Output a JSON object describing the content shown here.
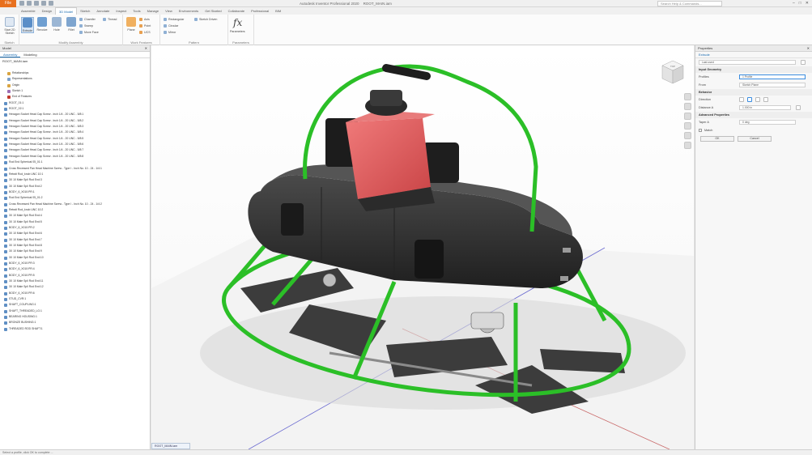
{
  "app": {
    "file_label": "File",
    "window_title": "Autodesk Inventor Professional 2020",
    "document_tab": "ROOT_MAIN.iam",
    "search_placeholder": "Search Help & Commands..."
  },
  "ribbon_tabs": [
    {
      "label": "Assemble",
      "active": false
    },
    {
      "label": "Design",
      "active": false
    },
    {
      "label": "3D Model",
      "active": true
    },
    {
      "label": "Sketch",
      "active": false
    },
    {
      "label": "Annotate",
      "active": false
    },
    {
      "label": "Inspect",
      "active": false
    },
    {
      "label": "Tools",
      "active": false
    },
    {
      "label": "Manage",
      "active": false
    },
    {
      "label": "View",
      "active": false
    },
    {
      "label": "Environments",
      "active": false
    },
    {
      "label": "Get Started",
      "active": false
    },
    {
      "label": "Collaborate",
      "active": false
    },
    {
      "label": "Professional",
      "active": false
    },
    {
      "label": "BIM",
      "active": false
    }
  ],
  "ribbon": {
    "groups": [
      {
        "label": "Sketch"
      },
      {
        "label": "Modify Assembly"
      },
      {
        "label": "Work Features"
      },
      {
        "label": "Pattern"
      },
      {
        "label": "Parameters"
      }
    ],
    "start_sketch": "Start 2D Sketch",
    "extrude": "Extrude",
    "revolve": "Revolve",
    "hole": "Hole",
    "fillet": "Fillet",
    "chamfer": "Chamfer",
    "sweep": "Sweep",
    "move_face": "Move Face",
    "thread": "Thread",
    "plane": "Plane",
    "axis": "Axis",
    "point": "Point",
    "ucs": "UCS",
    "rectangular": "Rectangular",
    "circular": "Circular",
    "mirror": "Mirror",
    "sketch_driven": "Sketch Driven",
    "parameters": "Parameters"
  },
  "model_panel": {
    "title": "Model",
    "tabs": [
      "Assembly",
      "Modeling"
    ],
    "root": "ROOT_MAIN.iam",
    "items": [
      "Relationships",
      "Representations",
      "Origin",
      "Sketch 1",
      "End of Features",
      "ROOT_01:1",
      "ROOT_02:1",
      "Hexagon Socket Head Cap Screw - Inch 1/4 - 20 UNC - 5/8:1",
      "Hexagon Socket Head Cap Screw - Inch 1/4 - 20 UNC - 5/8:2",
      "Hexagon Socket Head Cap Screw - Inch 1/4 - 20 UNC - 5/8:3",
      "Hexagon Socket Head Cap Screw - Inch 1/4 - 20 UNC - 5/8:4",
      "Hexagon Socket Head Cap Screw - Inch 1/4 - 20 UNC - 5/8:5",
      "Hexagon Socket Head Cap Screw - Inch 1/4 - 20 UNC - 5/8:6",
      "Hexagon Socket Head Cap Screw - Inch 1/4 - 20 UNC - 5/8:7",
      "Hexagon Socket Head Cap Screw - Inch 1/4 - 20 UNC - 5/8:8",
      "Rod End Spherical 05_01:1",
      "Cross Recessed Pan Head Machine Screw - Type I - Inch No. 10 - 24 - 1/4:1",
      "Retrait Rod_knob UNC 10:1",
      "3X 10 Male Spli Rod End:3",
      "3X 10 Male Spli Rod End:2",
      "BODY_6_X010:PR:1",
      "Rod End Spherical 05_01:2",
      "Cross Recessed Pan Head Machine Screw - Type I - Inch No. 10 - 24 - 1/4:2",
      "Retrait Rod_knob UNC 10:2",
      "3X 10 Male Spli Rod End:4",
      "3X 10 Male Spli Rod End:5",
      "BODY_6_X010:PR:2",
      "3X 10 Male Spli Rod End:6",
      "3X 10 Male Spli Rod End:7",
      "3X 10 Male Spli Rod End:8",
      "3X 10 Male Spli Rod End:9",
      "3X 10 Male Spli Rod End:10",
      "BODY_6_X010:PR:3",
      "BODY_6_X010:PR:4",
      "BODY_6_X010:PR:5",
      "3X 10 Male Spli Rod End:11",
      "3X 10 Male Spli Rod End:12",
      "BODY_6_X010:PR:6",
      "STUD_CVR:1",
      "SHAFT_COUPLING:1",
      "SHAFT_THREADED_LG:1",
      "BEARING HOUSING:1",
      "BRONZE BUSHING:1",
      "THREADED ROD SHAFT:1"
    ]
  },
  "viewport": {
    "tab_label": "ROOT_MAIN.iam",
    "cube_label": "TOP"
  },
  "properties": {
    "title": "Properties",
    "subtitle": "Extrude",
    "preset": "Last used",
    "input_geometry": "Input Geometry",
    "profiles_label": "Profiles",
    "profiles_value": "1 Profile",
    "from_label": "From",
    "from_value": "Sketch Plane",
    "behavior": "Behavior",
    "direction_label": "Direction",
    "distance_label": "Distance A",
    "distance_value": "1.000 in",
    "advanced": "Advanced Properties",
    "taper_label": "Taper A",
    "taper_value": "0 deg",
    "match_shape": "Match",
    "ok": "OK",
    "cancel": "Cancel"
  },
  "status": {
    "text": "Select a profile, click OK to complete ..."
  },
  "colors": {
    "accent": "#1a6bb0",
    "file_button": "#e8701e",
    "frame_green": "#2bbf27",
    "body_dark": "#2e2e2e",
    "motor_red": "#e0585a"
  }
}
